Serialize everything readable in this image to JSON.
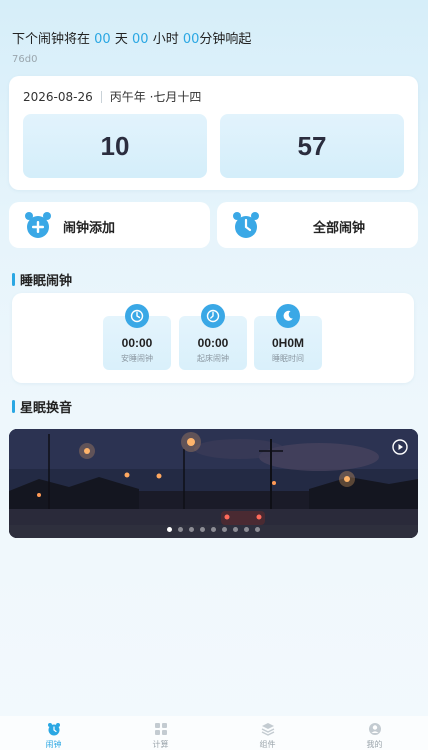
{
  "header": {
    "prefix": "下个闹钟将在",
    "days": "00",
    "days_unit": "天",
    "hours": "00",
    "hours_unit": "小时",
    "minutes": "00",
    "minutes_unit": "分钟响起",
    "subid": "76d0"
  },
  "date_card": {
    "date": "2026-08-26",
    "lunar": "丙午年 ·七月十四",
    "hour": "10",
    "minute": "57"
  },
  "actions": {
    "add_label": "闹钟添加",
    "all_label": "全部闹钟"
  },
  "sleep": {
    "title": "睡眠闹钟",
    "items": [
      {
        "value": "00:00",
        "caption": "安睡闹钟",
        "icon": "clock-icon"
      },
      {
        "value": "00:00",
        "caption": "起床闹钟",
        "icon": "clock-icon"
      },
      {
        "value": "0H0M",
        "caption": "睡眠时间",
        "icon": "moon-icon"
      }
    ]
  },
  "swap": {
    "title": "星眠换音",
    "banner_pages": 9,
    "active_page": 1
  },
  "tabs": [
    {
      "label": "闹钟",
      "icon": "alarm-clock-icon",
      "active": true
    },
    {
      "label": "计算",
      "icon": "calculator-icon",
      "active": false
    },
    {
      "label": "组件",
      "icon": "layers-icon",
      "active": false
    },
    {
      "label": "我的",
      "icon": "profile-icon",
      "active": false
    }
  ],
  "colors": {
    "accent": "#2aa7e3",
    "icon_blue": "#3aa8e6",
    "text_dark": "#222222"
  }
}
